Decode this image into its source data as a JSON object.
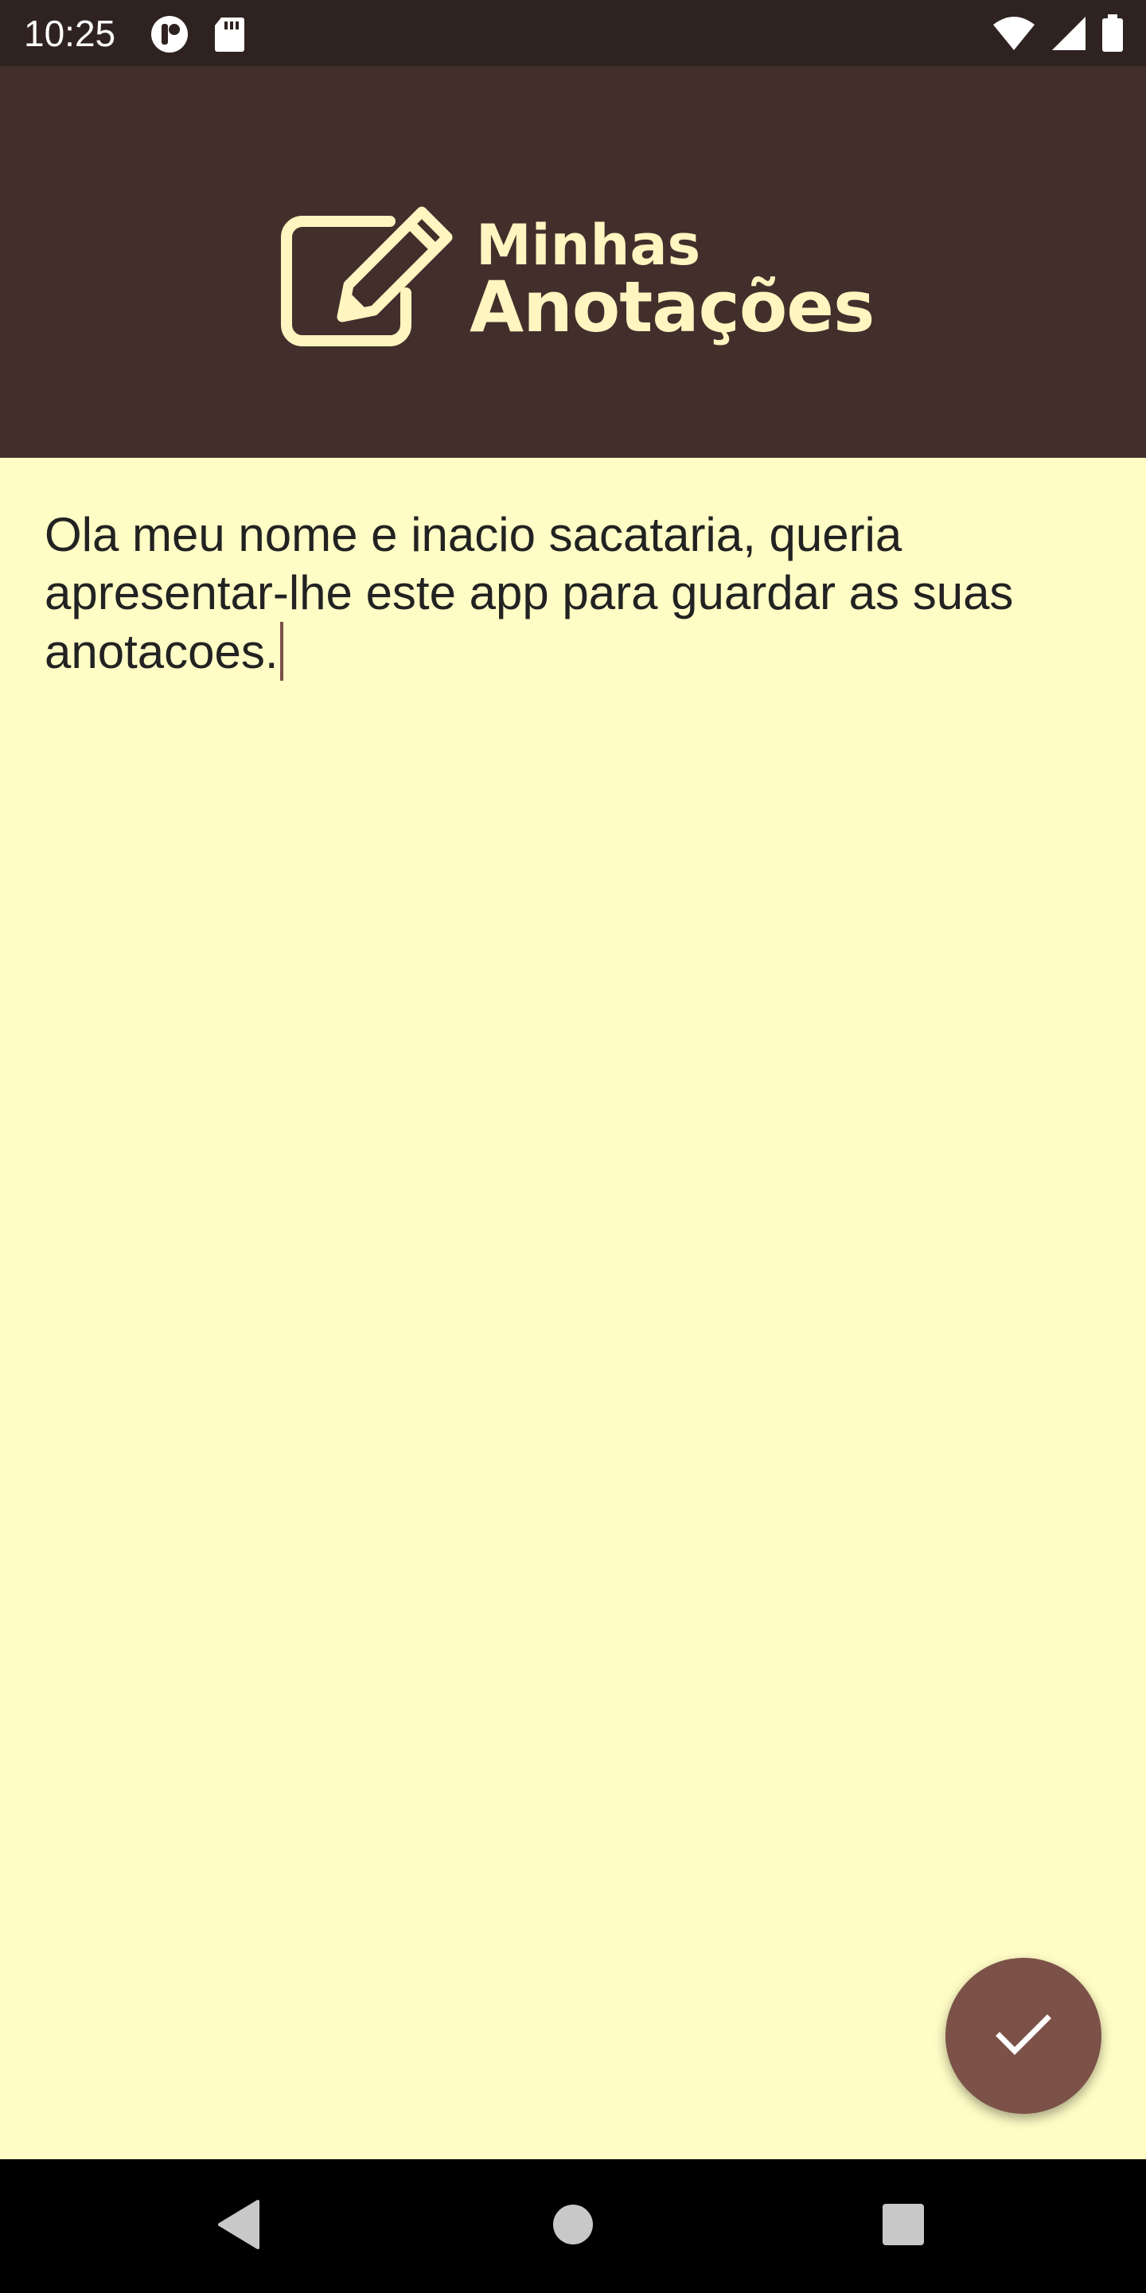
{
  "status_bar": {
    "time": "10:25",
    "icons": [
      "notification-app-icon",
      "sd-card-icon",
      "wifi-icon",
      "signal-icon",
      "battery-icon"
    ]
  },
  "app_bar": {
    "logo_line1": "Minhas",
    "logo_line2": "Anotações",
    "logo_icon": "edit-note-icon"
  },
  "note": {
    "text": "Ola meu nome e inacio sacataria, queria apresentar-lhe este app para guardar as suas anotacoes."
  },
  "fab": {
    "icon": "check-icon"
  },
  "nav_bar": {
    "buttons": [
      "back-icon",
      "home-icon",
      "recents-icon"
    ]
  },
  "colors": {
    "status_bar": "#2f2321",
    "app_bar": "#422f2c",
    "logo": "#fff5c0",
    "background": "#fffcc5",
    "fab": "#7b5148",
    "nav_bar": "#000000"
  }
}
